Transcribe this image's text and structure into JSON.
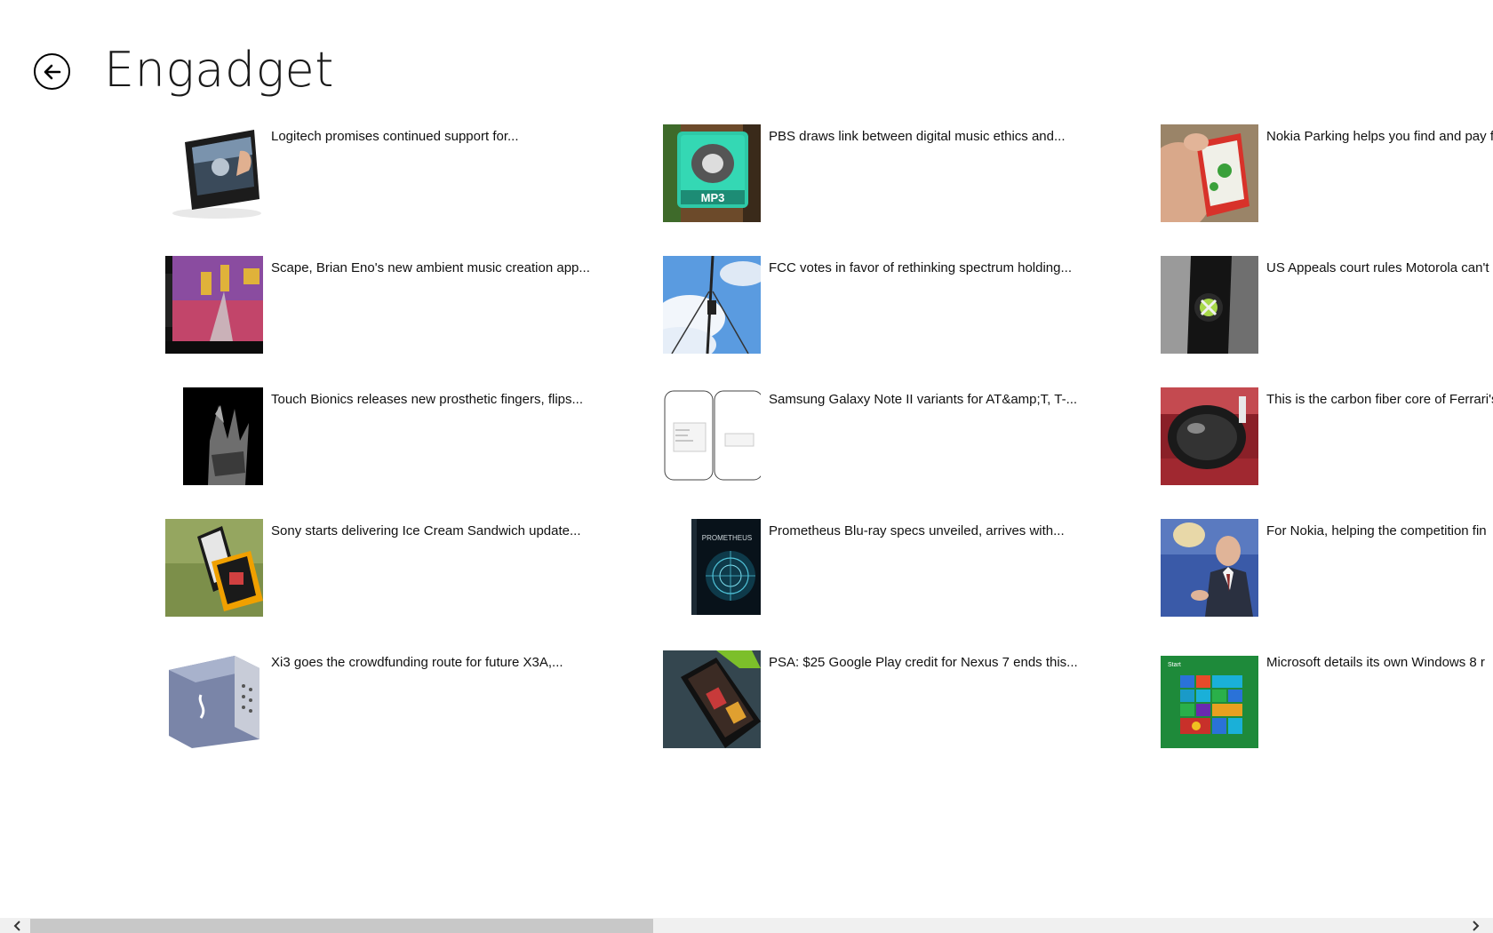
{
  "header": {
    "title": "Engadget",
    "back_icon": "back-arrow-icon"
  },
  "articles": [
    {
      "headline": "Logitech promises continued support for...",
      "thumb": "tablet-device"
    },
    {
      "headline": "Scape, Brian Eno's new ambient music creation app...",
      "thumb": "scape-app"
    },
    {
      "headline": "Touch Bionics releases new prosthetic fingers, flips...",
      "thumb": "bionic-hand"
    },
    {
      "headline": "Sony starts delivering Ice Cream Sandwich update...",
      "thumb": "sony-phones"
    },
    {
      "headline": "Xi3 goes the crowdfunding route for future X3A,...",
      "thumb": "xi3-computer"
    },
    {
      "headline": "PBS draws link between digital music ethics and...",
      "thumb": "mp3-icon"
    },
    {
      "headline": "FCC votes in favor of rethinking spectrum holding...",
      "thumb": "radio-tower"
    },
    {
      "headline": "Samsung Galaxy Note II variants for AT&amp;T, T-...",
      "thumb": "galaxy-note"
    },
    {
      "headline": "Prometheus Blu-ray specs unveiled, arrives with...",
      "thumb": "prometheus-bluray"
    },
    {
      "headline": "PSA: $25 Google Play credit for Nexus 7 ends this...",
      "thumb": "nexus7"
    },
    {
      "headline": "Nokia Parking helps you find and pay f",
      "thumb": "nokia-phone"
    },
    {
      "headline": "US Appeals court rules Motorola can't",
      "thumb": "xbox-console"
    },
    {
      "headline": "This is the carbon fiber core of Ferrari's",
      "thumb": "ferrari-core"
    },
    {
      "headline": "For Nokia, helping the competition fin",
      "thumb": "nokia-exec"
    },
    {
      "headline": "Microsoft details its own Windows 8 r",
      "thumb": "windows8-start"
    }
  ],
  "mp3_label": "MP3",
  "prometheus_label": "PROMETHEUS",
  "start_label": "Start",
  "colors": {
    "scroll_track": "#f0f0f0",
    "scroll_thumb": "#c8c8c8",
    "mp3_green": "#2ec9a7",
    "win8_green": "#1e8a3a"
  }
}
